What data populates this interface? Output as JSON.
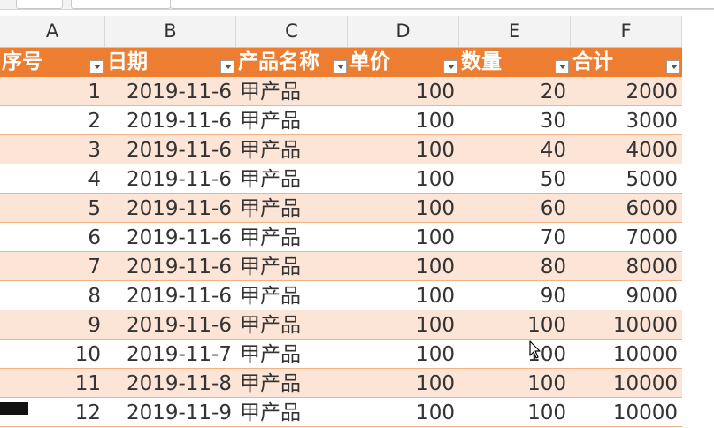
{
  "column_letters": [
    "A",
    "B",
    "C",
    "D",
    "E",
    "F"
  ],
  "table": {
    "headers": [
      "序号",
      "日期",
      "产品名称",
      "单价",
      "数量",
      "合计"
    ],
    "rows": [
      [
        "1",
        "2019-11-6",
        "甲产品",
        "100",
        "20",
        "2000"
      ],
      [
        "2",
        "2019-11-6",
        "甲产品",
        "100",
        "30",
        "3000"
      ],
      [
        "3",
        "2019-11-6",
        "甲产品",
        "100",
        "40",
        "4000"
      ],
      [
        "4",
        "2019-11-6",
        "甲产品",
        "100",
        "50",
        "5000"
      ],
      [
        "5",
        "2019-11-6",
        "甲产品",
        "100",
        "60",
        "6000"
      ],
      [
        "6",
        "2019-11-6",
        "甲产品",
        "100",
        "70",
        "7000"
      ],
      [
        "7",
        "2019-11-6",
        "甲产品",
        "100",
        "80",
        "8000"
      ],
      [
        "8",
        "2019-11-6",
        "甲产品",
        "100",
        "90",
        "9000"
      ],
      [
        "9",
        "2019-11-6",
        "甲产品",
        "100",
        "100",
        "10000"
      ],
      [
        "10",
        "2019-11-7",
        "甲产品",
        "100",
        "100",
        "10000"
      ],
      [
        "11",
        "2019-11-8",
        "甲产品",
        "100",
        "100",
        "10000"
      ],
      [
        "12",
        "2019-11-9",
        "甲产品",
        "100",
        "100",
        "10000"
      ]
    ]
  },
  "colors": {
    "header_fill": "#ed7d31",
    "band_fill": "#fce4d6",
    "row_border": "#f4b183"
  },
  "icons": {
    "filter": "filter-dropdown-icon",
    "cursor": "mouse-pointer-icon"
  }
}
